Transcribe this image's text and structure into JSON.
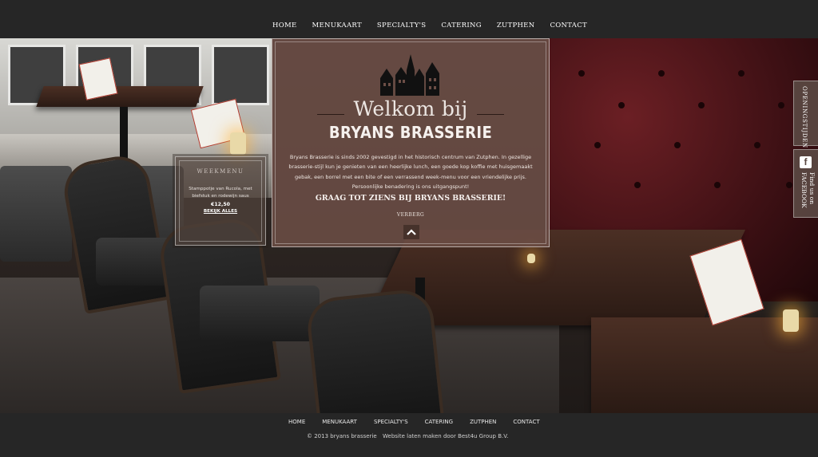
{
  "top_nav": {
    "items": [
      "HOME",
      "MENUKAART",
      "SPECIALTY'S",
      "CATERING",
      "ZUTPHEN",
      "CONTACT"
    ]
  },
  "weekmenu": {
    "title": "WEEKMENU",
    "description": "Stamppotje van Rucola, met biefstuk en rodewijn saus",
    "price": "€12,50",
    "link": "BEKIJK ALLES"
  },
  "welcome": {
    "heading": "Welkom bij",
    "subheading": "BRYANS BRASSERIE",
    "body": "Bryans Brasserie is sinds 2002 gevestigd in het historisch centrum van Zutphen. In gezellige brasserie-stijl kun je genieten van een heerlijke lunch, een goede kop koffie met huisgemaakt gebak, een borrel met een bite of een verrassend week-menu voor een vriendelijke prijs. Persoonlijke benadering is ons uitgangspunt!",
    "tagline": "GRAAG TOT ZIENS BIJ BRYANS BRASSERIE!",
    "hide_label": "VERBERG"
  },
  "side_tabs": {
    "hours": "OPENINGSTIJDEN",
    "facebook": "Find us on FACEBOOK"
  },
  "footer": {
    "items": [
      "HOME",
      "MENUKAART",
      "SPECIALTY'S",
      "CATERING",
      "ZUTPHEN",
      "CONTACT"
    ],
    "copyright": "© 2013 bryans brasserie",
    "credit": "Website laten maken door Best4u Group B.V."
  },
  "colors": {
    "panel": "#6c4e46",
    "nav_bg": "#262626",
    "booth": "#5a1a1f"
  }
}
